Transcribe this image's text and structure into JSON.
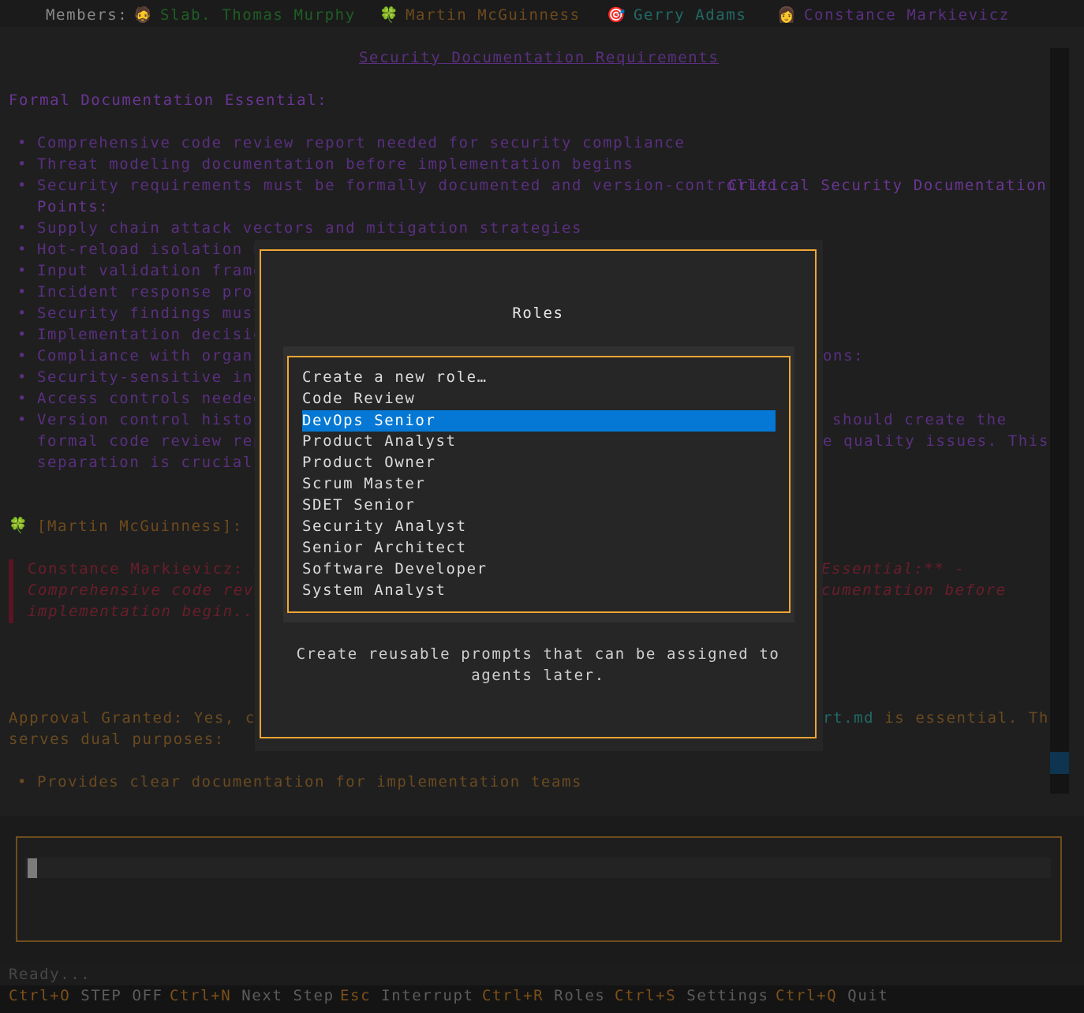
{
  "members_bar": {
    "label": "Members:",
    "members": [
      {
        "emoji": "🧔",
        "name": "Slab. Thomas Murphy",
        "color": "#1f5e25"
      },
      {
        "emoji": "🍀",
        "name": "Martin McGuinness",
        "color": "#6e4a1d"
      },
      {
        "emoji": "🎯",
        "name": "Gerry Adams",
        "color": "#206a66"
      },
      {
        "emoji": "👩",
        "name": "Constance Markievicz",
        "color": "#5a2f80"
      }
    ]
  },
  "chat": {
    "doc_title": "Security Documentation Requirements",
    "section_heading": "Formal Documentation Essential:",
    "bullets_full": [
      "Comprehensive code review report needed for security compliance",
      "Threat modeling documentation before implementation begins"
    ],
    "bullet_security_req": "Security requirements must be formally documented and version-controlled",
    "critical_label_1": "Critical Security Documentation",
    "critical_label_2": "Points:",
    "bullet_supply_chain": "Supply chain attack vectors and mitigation strategies",
    "bullets_partial": [
      "Hot-reload isolation bo",
      "Input validation framew",
      "Incident response proce",
      "Security findings must",
      "Implementation decision",
      "Compliance with organiz",
      "Security-sensitive info",
      "Access controls needed",
      "Version control history"
    ],
    "right_ons": "ons:",
    "right_should": "should create the",
    "cont_formal": "formal code review repo",
    "right_quality": "e quality issues. This",
    "cont_separation": "separation is crucial f",
    "speaker_emoji": "🍀",
    "speaker_name": "[Martin McGuinness]:",
    "quote_line1": "Constance Markievicz: ##",
    "quote_right1": "Essential:** -",
    "quote_line2": "Comprehensive code revie",
    "quote_right2": "cumentation before",
    "quote_line3": "implementation begin...",
    "approval_label": "Approval Granted:",
    "approval_text": " Yes, cre",
    "approval_file": "rt.md",
    "approval_right": " is essential. This",
    "approval_cont": "serves dual purposes:",
    "bullet_provides": "Provides clear documentation for implementation teams"
  },
  "modal": {
    "title": "Roles",
    "roles": [
      "Create a new role…",
      "Code Review",
      "DevOps Senior",
      "Product Analyst",
      "Product Owner",
      "Scrum Master",
      "SDET Senior",
      "Security Analyst",
      "Senior Architect",
      "Software Developer",
      "System Analyst"
    ],
    "selected_role": "DevOps Senior",
    "description": "Create reusable prompts that can be assigned to agents later."
  },
  "status": "Ready...",
  "footer": {
    "shortcuts": [
      {
        "key": "Ctrl+O",
        "label": "STEP OFF"
      },
      {
        "key": "Ctrl+N",
        "label": "Next Step"
      },
      {
        "key": "Esc",
        "label": "Interrupt"
      },
      {
        "key": "Ctrl+R",
        "label": "Roles"
      },
      {
        "key": "Ctrl+S",
        "label": "Settings"
      },
      {
        "key": "Ctrl+Q",
        "label": "Quit"
      }
    ]
  },
  "colors": {
    "accent_border": "#f2a533",
    "selection": "#0478d4",
    "input_border": "#6e4d1c"
  }
}
